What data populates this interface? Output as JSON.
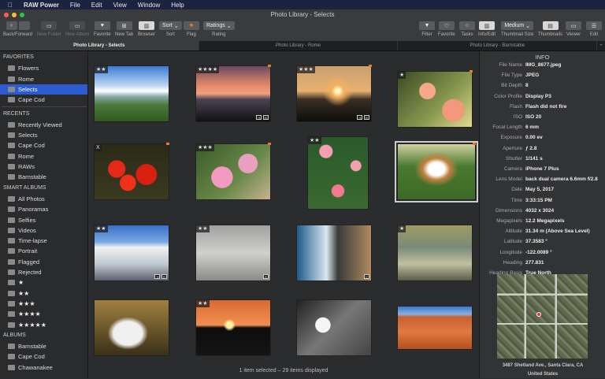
{
  "menubar": {
    "app": "RAW Power",
    "items": [
      "File",
      "Edit",
      "View",
      "Window",
      "Help"
    ]
  },
  "window": {
    "title": "Photo Library - Selects"
  },
  "toolbar": {
    "back_forward": "Back/Forward",
    "new_folder": "New Folder",
    "new_album": "New Album",
    "favorite": "Favorite",
    "new_tab": "New Tab",
    "browser": "Browser",
    "sort_value": "Sort",
    "sort": "Sort",
    "flag": "Flag",
    "rating_value": "Ratings",
    "rating": "Rating",
    "filter": "Filter",
    "favorite2": "Favorite",
    "tasks": "Tasks",
    "info_edit": "Info/Edit",
    "thumb_size_value": "Medium",
    "thumb_size": "Thumbnail Size",
    "thumbnails": "Thumbnails",
    "viewer": "Viewer",
    "edit": "Edit"
  },
  "tabs": [
    {
      "label": "Photo Library - Selects",
      "active": true
    },
    {
      "label": "Photo Library - Rome"
    },
    {
      "label": "Photo Library - Barnstable"
    }
  ],
  "tab_add": "+",
  "sidebar": {
    "favorites_header": "FAVORITES",
    "favorites": [
      "Flowers",
      "Rome",
      "Selects",
      "Cape Cod"
    ],
    "selected": "Selects",
    "recents_header": "RECENTS",
    "recents": [
      "Recently Viewed",
      "Selects",
      "Cape Cod",
      "Rome",
      "RAWs",
      "Barnstable"
    ],
    "smart_header": "SMART ALBUMS",
    "smart": [
      "All Photos",
      "Panoramas",
      "Selfies",
      "Videos",
      "Time-lapse",
      "Portrait",
      "Flagged",
      "Rejected",
      "★",
      "★★",
      "★★★",
      "★★★★",
      "★★★★★"
    ],
    "albums_header": "ALBUMS",
    "albums": [
      "Barnstable",
      "Cape Cod",
      "Chawanakee"
    ]
  },
  "photos": [
    {
      "rating": "★★",
      "subject": "sky"
    },
    {
      "rating": "★★★★",
      "subject": "sunset-palm",
      "flag": true,
      "badges": [
        "⇥",
        "R"
      ]
    },
    {
      "rating": "★★★",
      "subject": "sunset",
      "flag": true,
      "badges": [
        "⇥",
        "R"
      ]
    },
    {
      "rating": "★",
      "subject": "roses-peach",
      "flag": true
    },
    {
      "rating": "X",
      "subject": "roses-red",
      "flag": true
    },
    {
      "rating": "★★★",
      "subject": "pink-flowers",
      "flag": true
    },
    {
      "rating": "★★",
      "subject": "rose-bush"
    },
    {
      "rating": "",
      "subject": "dog",
      "flag": true,
      "selected": true
    },
    {
      "rating": "★★",
      "subject": "santorini",
      "badges": [
        "⇥",
        "R"
      ]
    },
    {
      "rating": "★★",
      "subject": "fountain",
      "badges": [
        "R"
      ]
    },
    {
      "rating": "",
      "subject": "coast",
      "badges": [
        "◱"
      ]
    },
    {
      "rating": "★",
      "subject": "jet"
    },
    {
      "rating": "",
      "subject": "rabbits"
    },
    {
      "rating": "★★",
      "subject": "sunset-orange"
    },
    {
      "rating": "",
      "subject": "bw-flower"
    },
    {
      "rating": "",
      "subject": "canyon"
    }
  ],
  "status": "1 item selected – 29 items displayed",
  "info": {
    "title": "INFO",
    "rows": [
      {
        "k": "File Name",
        "v": "IMG_8677.jpeg"
      },
      {
        "k": "File Type",
        "v": "JPEG"
      },
      {
        "k": "Bit Depth",
        "v": "8"
      },
      {
        "k": "Color Profile",
        "v": "Display P3"
      },
      {
        "k": "Flash",
        "v": "Flash did not fire"
      },
      {
        "k": "ISO",
        "v": "ISO 20"
      },
      {
        "k": "Focal Length",
        "v": "6 mm"
      },
      {
        "k": "Exposure",
        "v": "0.00 ev"
      },
      {
        "k": "Aperture",
        "v": "ƒ 2.8"
      },
      {
        "k": "Shutter",
        "v": "1/141 s"
      },
      {
        "k": "Camera",
        "v": "iPhone 7 Plus"
      },
      {
        "k": "Lens Model",
        "v": "back dual camera 6.6mm f/2.8"
      },
      {
        "k": "Date",
        "v": "May 5, 2017"
      },
      {
        "k": "Time",
        "v": "3:33:15 PM"
      },
      {
        "k": "Dimensions",
        "v": "4032 x 3024"
      },
      {
        "k": "Megapixels",
        "v": "12.2 Megapixels"
      },
      {
        "k": "Altitude",
        "v": "31.34 m (Above Sea Level)"
      },
      {
        "k": "Latitude",
        "v": "37.3583 °"
      },
      {
        "k": "Longitude",
        "v": "-122.0089 °"
      },
      {
        "k": "Heading",
        "v": "277.831"
      },
      {
        "k": "Heading Basis",
        "v": "True North"
      }
    ],
    "address_line1": "3487 Shetland Ave., Santa Clara, CA",
    "address_line2": "United States"
  },
  "colors": {
    "selection": "#2c5bd0",
    "flag": "#e87a2a",
    "menubar": "#1c2340"
  }
}
